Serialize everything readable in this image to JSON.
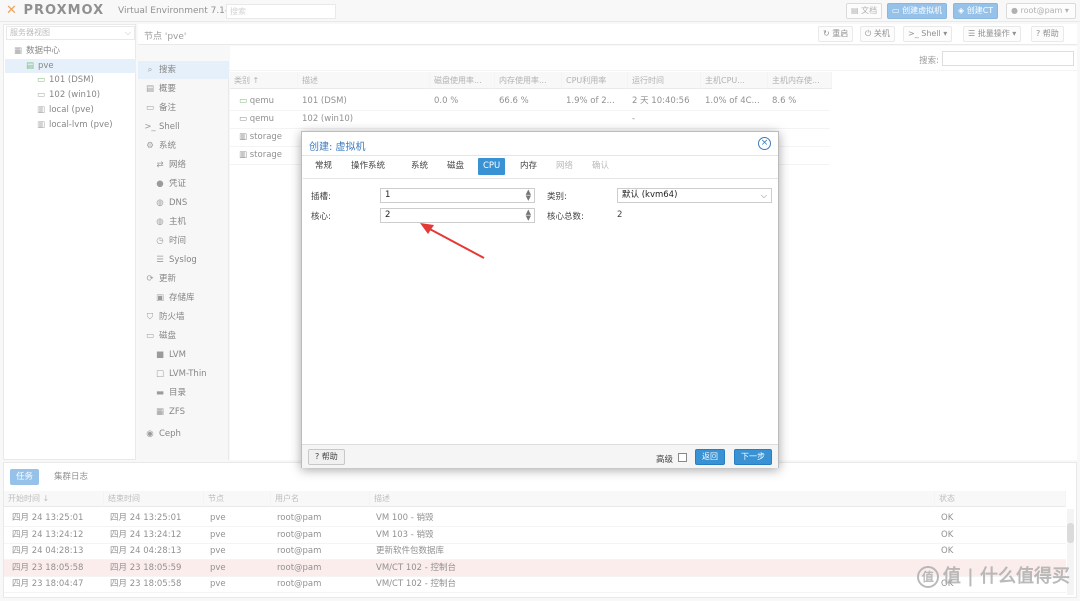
{
  "app": {
    "logo": "PROXMOX",
    "version": "Virtual Environment 7.1-7",
    "search_placeholder": "搜索",
    "buttons": {
      "docs": "文档",
      "create_vm": "创建虚拟机",
      "create_ct": "创建CT",
      "user": "root@pam"
    }
  },
  "tree": {
    "view_selector": "服务器视图",
    "items": [
      {
        "label": "数据中心",
        "icon": "datacenter-icon"
      },
      {
        "label": "pve",
        "icon": "node-icon"
      },
      {
        "label": "101 (DSM)",
        "icon": "vm-running-icon"
      },
      {
        "label": "102 (win10)",
        "icon": "vm-stopped-icon"
      },
      {
        "label": "local (pve)",
        "icon": "storage-icon"
      },
      {
        "label": "local-lvm (pve)",
        "icon": "storage-icon"
      }
    ]
  },
  "node_header": {
    "title": "节点 'pve'",
    "buttons": {
      "reboot": "重启",
      "shutdown": "关机",
      "shell": "Shell",
      "bulk": "批量操作",
      "help": "帮助"
    }
  },
  "nav": [
    {
      "label": "搜索",
      "icon": "search-icon",
      "selected": true
    },
    {
      "label": "概要",
      "icon": "summary-icon"
    },
    {
      "label": "备注",
      "icon": "notes-icon"
    },
    {
      "label": "Shell",
      "icon": "terminal-icon"
    },
    {
      "label": "系统",
      "icon": "gear-icon"
    },
    {
      "label": "网络",
      "icon": "network-icon"
    },
    {
      "label": "凭证",
      "icon": "certificate-icon"
    },
    {
      "label": "DNS",
      "icon": "globe-icon"
    },
    {
      "label": "主机",
      "icon": "globe-icon"
    },
    {
      "label": "时间",
      "icon": "clock-icon"
    },
    {
      "label": "Syslog",
      "icon": "list-icon"
    },
    {
      "label": "更新",
      "icon": "refresh-icon"
    },
    {
      "label": "存储库",
      "icon": "repository-icon"
    },
    {
      "label": "防火墙",
      "icon": "shield-icon"
    },
    {
      "label": "磁盘",
      "icon": "disk-icon"
    },
    {
      "label": "LVM",
      "icon": "square-icon"
    },
    {
      "label": "LVM-Thin",
      "icon": "square-outline-icon"
    },
    {
      "label": "目录",
      "icon": "folder-icon"
    },
    {
      "label": "ZFS",
      "icon": "grid-icon"
    },
    {
      "label": "Ceph",
      "icon": "ceph-icon"
    }
  ],
  "grid": {
    "search_label": "搜索:",
    "headers": [
      "类别 ↑",
      "描述",
      "磁盘使用率...",
      "内存使用率...",
      "CPU利用率",
      "运行时间",
      "主机CPU...",
      "主机内存使..."
    ],
    "rows": [
      [
        "qemu",
        "101 (DSM)",
        "0.0 %",
        "66.6 %",
        "1.9% of 2...",
        "2 天 10:40:56",
        "1.0% of 4C...",
        "8.6 %"
      ],
      [
        "qemu",
        "102 (win10)",
        "",
        "",
        "",
        "-",
        "",
        ""
      ],
      [
        "storage",
        "",
        "",
        "",
        "",
        "",
        "",
        ""
      ],
      [
        "storage",
        "",
        "",
        "",
        "",
        "",
        "",
        ""
      ]
    ]
  },
  "dialog": {
    "title": "创建: 虚拟机",
    "tabs": [
      "常规",
      "操作系统",
      "系统",
      "磁盘",
      "CPU",
      "内存",
      "网络",
      "确认"
    ],
    "fields": {
      "sockets_label": "插槽:",
      "sockets_value": "1",
      "cores_label": "核心:",
      "cores_value": "2",
      "type_label": "类别:",
      "type_value": "默认 (kvm64)",
      "total_cores_label": "核心总数:",
      "total_cores_value": "2"
    },
    "footer": {
      "help": "帮助",
      "advanced": "高级",
      "back": "返回",
      "next": "下一步"
    }
  },
  "tasks": {
    "tabs": [
      "任务",
      "集群日志"
    ],
    "headers": [
      "开始时间 ↓",
      "结束时间",
      "节点",
      "用户名",
      "描述",
      "状态"
    ],
    "rows": [
      [
        "四月 24 13:25:01",
        "四月 24 13:25:01",
        "pve",
        "root@pam",
        "VM 100 - 销毁",
        "OK",
        false
      ],
      [
        "四月 24 13:24:12",
        "四月 24 13:24:12",
        "pve",
        "root@pam",
        "VM 103 - 销毁",
        "OK",
        false
      ],
      [
        "四月 24 04:28:13",
        "四月 24 04:28:13",
        "pve",
        "root@pam",
        "更新软件包数据库",
        "OK",
        false
      ],
      [
        "四月 23 18:05:58",
        "四月 23 18:05:59",
        "pve",
        "root@pam",
        "VM/CT 102 - 控制台",
        "",
        true
      ],
      [
        "四月 23 18:04:47",
        "四月 23 18:05:58",
        "pve",
        "root@pam",
        "VM/CT 102 - 控制台",
        "OK",
        false
      ]
    ]
  },
  "watermark": "值 | 什么值得买",
  "colors": {
    "accent": "#3892d4",
    "brand_orange": "#e57000",
    "arrow": "#e53935",
    "selected_bg": "#d9e9f7"
  }
}
